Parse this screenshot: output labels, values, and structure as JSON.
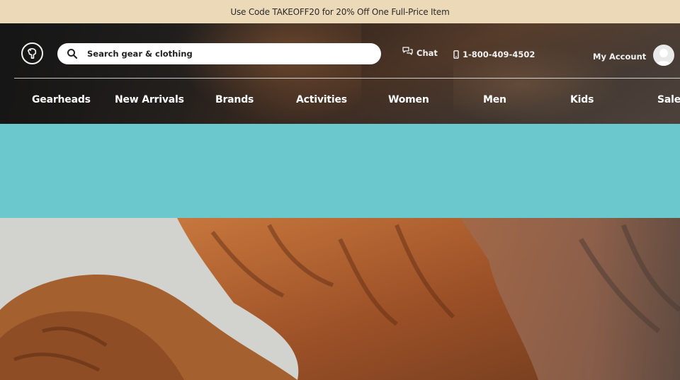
{
  "promo": {
    "text": "Use Code TAKEOFF20 for 20% Off One Full-Price Item"
  },
  "header": {
    "logo_icon": "goat-head-logo-icon",
    "search": {
      "placeholder": "Search gear & clothing",
      "icon": "search-icon"
    },
    "chat": {
      "label": "Chat",
      "icon": "chat-bubbles-icon"
    },
    "phone": {
      "label": "1-800-409-4502",
      "icon": "mobile-phone-icon"
    },
    "account": {
      "label": "My Account",
      "icon": "user-avatar-icon"
    }
  },
  "nav": {
    "items": [
      {
        "label": "Gearheads"
      },
      {
        "label": "New Arrivals"
      },
      {
        "label": "Brands"
      },
      {
        "label": "Activities"
      },
      {
        "label": "Women"
      },
      {
        "label": "Men"
      },
      {
        "label": "Kids"
      },
      {
        "label": "Sale"
      }
    ]
  },
  "colors": {
    "promo_bg": "#ecd9b8",
    "banner_teal": "#6bc8cd",
    "header_text": "#ffffff"
  }
}
